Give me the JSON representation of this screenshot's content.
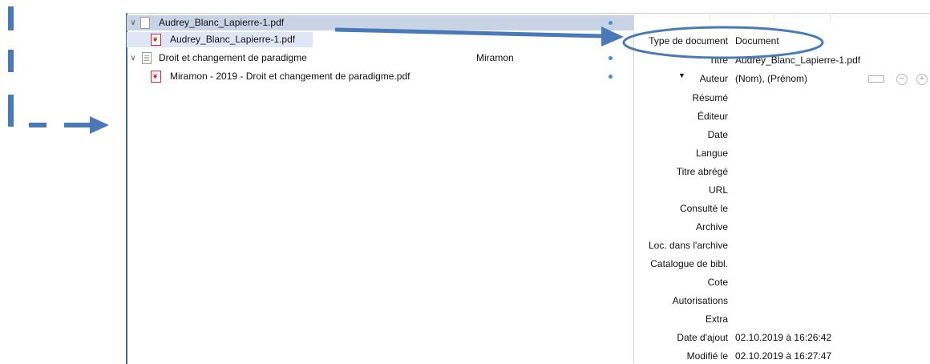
{
  "tree": {
    "items": [
      {
        "name": "Audrey_Blanc_Lapierre-1.pdf",
        "creator": ""
      },
      {
        "name": "Audrey_Blanc_Lapierre-1.pdf",
        "creator": ""
      },
      {
        "name": "Droit et changement de paradigme",
        "creator": "Miramon"
      },
      {
        "name": "Miramon - 2019 - Droit et changement de paradigme.pdf",
        "creator": ""
      }
    ]
  },
  "info": {
    "fields": [
      {
        "label": "Type de document",
        "value": "Document"
      },
      {
        "label": "Titre",
        "value": "Audrey_Blanc_Lapierre-1.pdf"
      },
      {
        "label": "Auteur",
        "value": "(Nom), (Prénom)"
      },
      {
        "label": "Résumé",
        "value": ""
      },
      {
        "label": "Éditeur",
        "value": ""
      },
      {
        "label": "Date",
        "value": ""
      },
      {
        "label": "Langue",
        "value": ""
      },
      {
        "label": "Titre abrégé",
        "value": ""
      },
      {
        "label": "URL",
        "value": ""
      },
      {
        "label": "Consulté le",
        "value": ""
      },
      {
        "label": "Archive",
        "value": ""
      },
      {
        "label": "Loc. dans l'archive",
        "value": ""
      },
      {
        "label": "Catalogue de bibl.",
        "value": ""
      },
      {
        "label": "Cote",
        "value": ""
      },
      {
        "label": "Autorisations",
        "value": ""
      },
      {
        "label": "Extra",
        "value": ""
      },
      {
        "label": "Date d'ajout",
        "value": "02.10.2019 à 16:26:42"
      },
      {
        "label": "Modifié le",
        "value": "02.10.2019 à 16:27:47"
      }
    ],
    "author_controls": {
      "minus": "−",
      "plus": "+"
    }
  },
  "icons": {
    "expand": "chevron-down-icon",
    "pdf": "pdf-icon",
    "document": "document-icon"
  },
  "colors": {
    "accent": "#4a79b8",
    "selection": "#c9d3e6",
    "selection_light": "#dfe6f5",
    "dot": "#3d8fe0"
  }
}
